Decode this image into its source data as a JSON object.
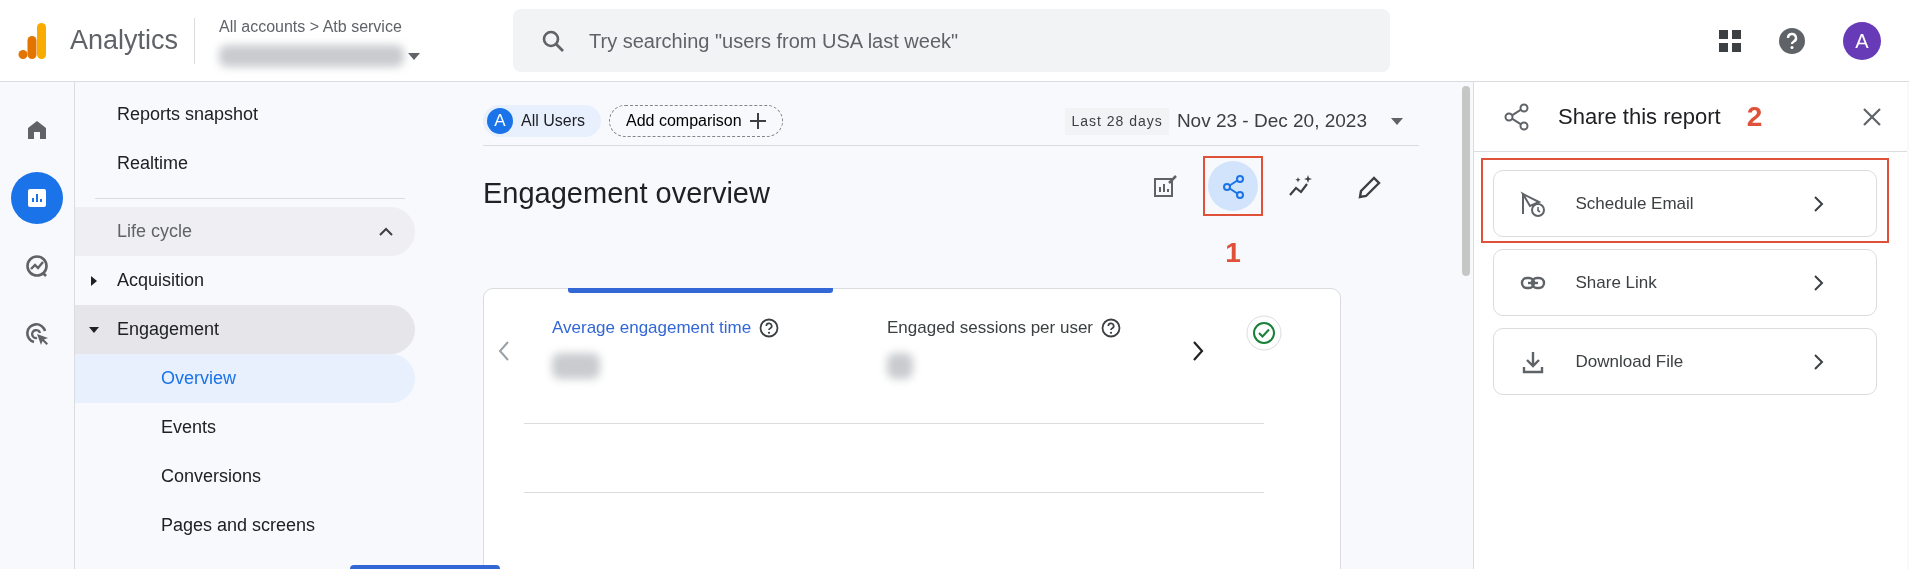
{
  "app": {
    "title": "Analytics",
    "breadcrumb": "All accounts > Atb service"
  },
  "search": {
    "placeholder": "Try searching \"users from USA last week\""
  },
  "account": {
    "avatar": "A"
  },
  "rail": [
    {
      "selected": false
    },
    {
      "selected": true
    },
    {
      "selected": false
    },
    {
      "selected": false
    }
  ],
  "nav": [
    {
      "kind": "link",
      "label": "Reports snapshot",
      "selected": false
    },
    {
      "kind": "link",
      "label": "Realtime",
      "selected": false
    },
    {
      "kind": "section",
      "label": "Life cycle",
      "expanded": true,
      "children": [
        {
          "kind": "group",
          "label": "Acquisition",
          "expanded": false
        },
        {
          "kind": "group",
          "label": "Engagement",
          "expanded": true,
          "children": [
            {
              "kind": "link",
              "label": "Overview",
              "selected": true
            },
            {
              "kind": "link",
              "label": "Events",
              "selected": false
            },
            {
              "kind": "link",
              "label": "Conversions",
              "selected": false
            },
            {
              "kind": "link",
              "label": "Pages and screens",
              "selected": false
            }
          ]
        }
      ]
    }
  ],
  "filters": {
    "segment": {
      "badge": "A",
      "label": "All Users"
    },
    "add": "Add comparison",
    "range_label": "Last 28 days",
    "range": "Nov 23 - Dec 20, 2023"
  },
  "report": {
    "title": "Engagement overview",
    "actions": [
      {
        "highlighted": false,
        "selected": false
      },
      {
        "highlighted": true,
        "selected": true
      },
      {
        "highlighted": false,
        "selected": false
      },
      {
        "highlighted": false,
        "selected": false
      }
    ],
    "metrics": [
      {
        "label": "Average engagement time",
        "selected": true
      },
      {
        "label": "Engaged sessions per user",
        "selected": false
      }
    ]
  },
  "share_panel": {
    "title": "Share this report",
    "options": [
      {
        "label": "Schedule Email",
        "highlighted": true
      },
      {
        "label": "Share Link",
        "highlighted": false
      },
      {
        "label": "Download File",
        "highlighted": false
      }
    ]
  },
  "annotations": [
    {
      "label": "1"
    },
    {
      "label": "2"
    }
  ]
}
